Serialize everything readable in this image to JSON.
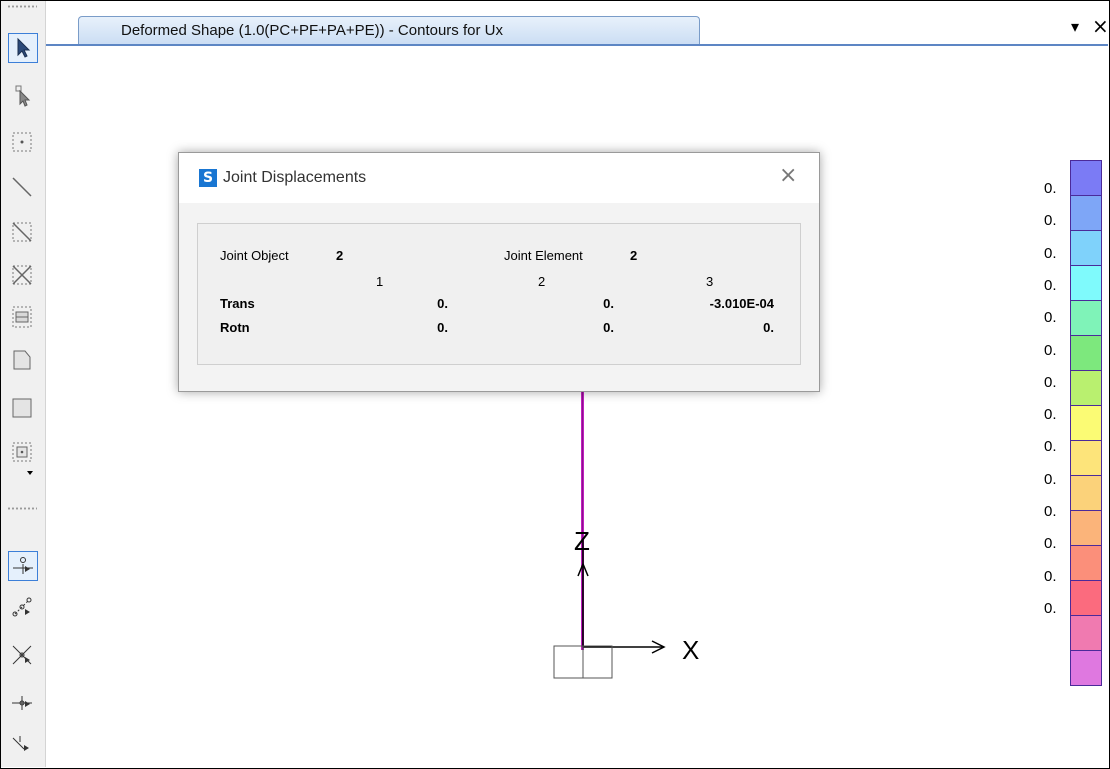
{
  "tab": {
    "title": "Deformed Shape (1.0(PC+PF+PA+PE)) - Contours for Ux"
  },
  "window_controls": {
    "dropdown": "▾",
    "close": "×"
  },
  "dialog": {
    "title": "Joint Displacements",
    "logo": "S",
    "close": "×",
    "joint_object_label": "Joint  Object",
    "joint_object_value": "2",
    "joint_element_label": "Joint Element",
    "joint_element_value": "2",
    "col_headers": [
      "1",
      "2",
      "3"
    ],
    "rows": [
      {
        "label": "Trans",
        "values": [
          "0.",
          "0.",
          "-3.010E-04"
        ]
      },
      {
        "label": "Rotn",
        "values": [
          "0.",
          "0.",
          "0."
        ]
      }
    ]
  },
  "axes": {
    "z": "Z",
    "x": "X"
  },
  "legend": {
    "labels": [
      "0.",
      "0.",
      "0.",
      "0.",
      "0.",
      "0.",
      "0.",
      "0.",
      "0.",
      "0.",
      "0.",
      "0.",
      "0.",
      "0."
    ],
    "colors": [
      "#7b7bf5",
      "#7ea6f7",
      "#7fd2fb",
      "#7ffafc",
      "#7ff3b8",
      "#7de87d",
      "#b9f06f",
      "#fbfb74",
      "#fde47a",
      "#fbd27a",
      "#fbb47a",
      "#fb8f7a",
      "#fb6b7e",
      "#f07ab0",
      "#df78e0"
    ]
  },
  "toolbar": {
    "tools": [
      "pointer-tool",
      "reshaper-tool",
      "draw-joint-tool",
      "draw-frame-tool",
      "quick-draw-frame-tool",
      "draw-brace-tool",
      "quick-draw-area-tool",
      "draw-poly-area-tool",
      "draw-rect-area-tool",
      "quick-draw-rect-tool",
      "snap-joints-tool",
      "snap-points-tool",
      "snap-intersections-tool",
      "snap-perpendicular-tool",
      "snap-lines-tool"
    ]
  }
}
